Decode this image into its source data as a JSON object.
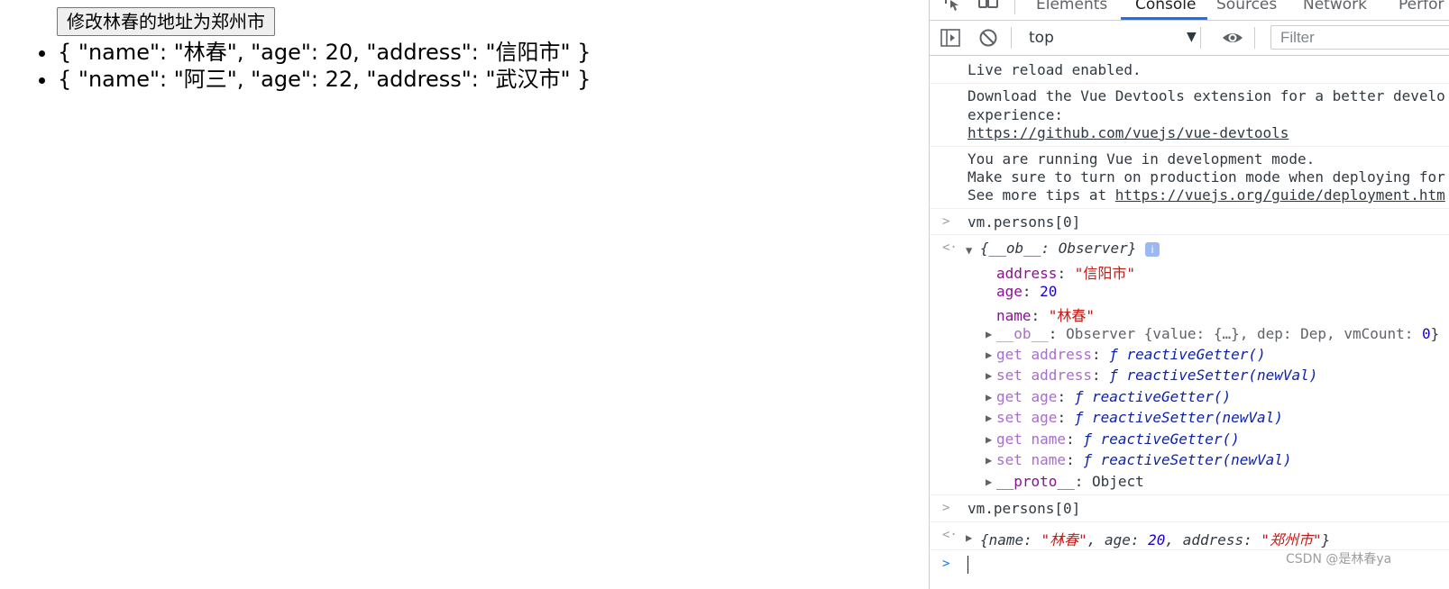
{
  "page": {
    "button_label": "修改林春的地址为郑州市",
    "persons": [
      "{ \"name\": \"林春\", \"age\": 20, \"address\": \"信阳市\" }",
      "{ \"name\": \"阿三\", \"age\": 22, \"address\": \"武汉市\" }"
    ]
  },
  "devtools": {
    "tabs": [
      "Elements",
      "Console",
      "Sources",
      "Network",
      "Perfor"
    ],
    "active_tab": "Console",
    "context": "top",
    "filter_placeholder": "Filter",
    "accent": "#1a73e8",
    "icons": [
      "inspect-icon",
      "device-toolbar-icon",
      "sidebar-toggle-icon",
      "clear-console-icon",
      "eye-icon"
    ]
  },
  "console": {
    "live_reload": "Live reload enabled.",
    "vue_devtools": {
      "line1": "Download the Vue Devtools extension for a better develo",
      "line2": "experience:",
      "link": "https://github.com/vuejs/vue-devtools"
    },
    "vue_dev_mode": {
      "line1": "You are running Vue in development mode.",
      "line2": "Make sure to turn on production mode when deploying for",
      "line3_prefix": "See more tips at ",
      "link": "https://vuejs.org/guide/deployment.htm"
    },
    "input1": "vm.persons[0]",
    "object1": {
      "summary_key": "__ob__",
      "summary_val": "Observer",
      "address_key": "address",
      "address_val": "\"信阳市\"",
      "age_key": "age",
      "age_val": "20",
      "name_key": "name",
      "name_val": "\"林春\"",
      "ob_key": "__ob__",
      "ob_prefix": "Observer {value: {…}, dep: Dep, vmCount: ",
      "ob_count": "0",
      "ob_suffix": "}",
      "getters": [
        {
          "label": "get address",
          "fn": "reactiveGetter()"
        },
        {
          "label": "set address",
          "fn": "reactiveSetter(newVal)"
        },
        {
          "label": "get age",
          "fn": "reactiveGetter()"
        },
        {
          "label": "set age",
          "fn": "reactiveSetter(newVal)"
        },
        {
          "label": "get name",
          "fn": "reactiveGetter()"
        },
        {
          "label": "set name",
          "fn": "reactiveSetter(newVal)"
        }
      ],
      "proto_key": "__proto__",
      "proto_val": "Object"
    },
    "input2": "vm.persons[0]",
    "object2": {
      "name_key": "name",
      "name_val": "\"林春\"",
      "age_key": "age",
      "age_val": "20",
      "address_key": "address",
      "address_val": "\"郑州市\""
    }
  },
  "watermark": "CSDN @是林春ya"
}
